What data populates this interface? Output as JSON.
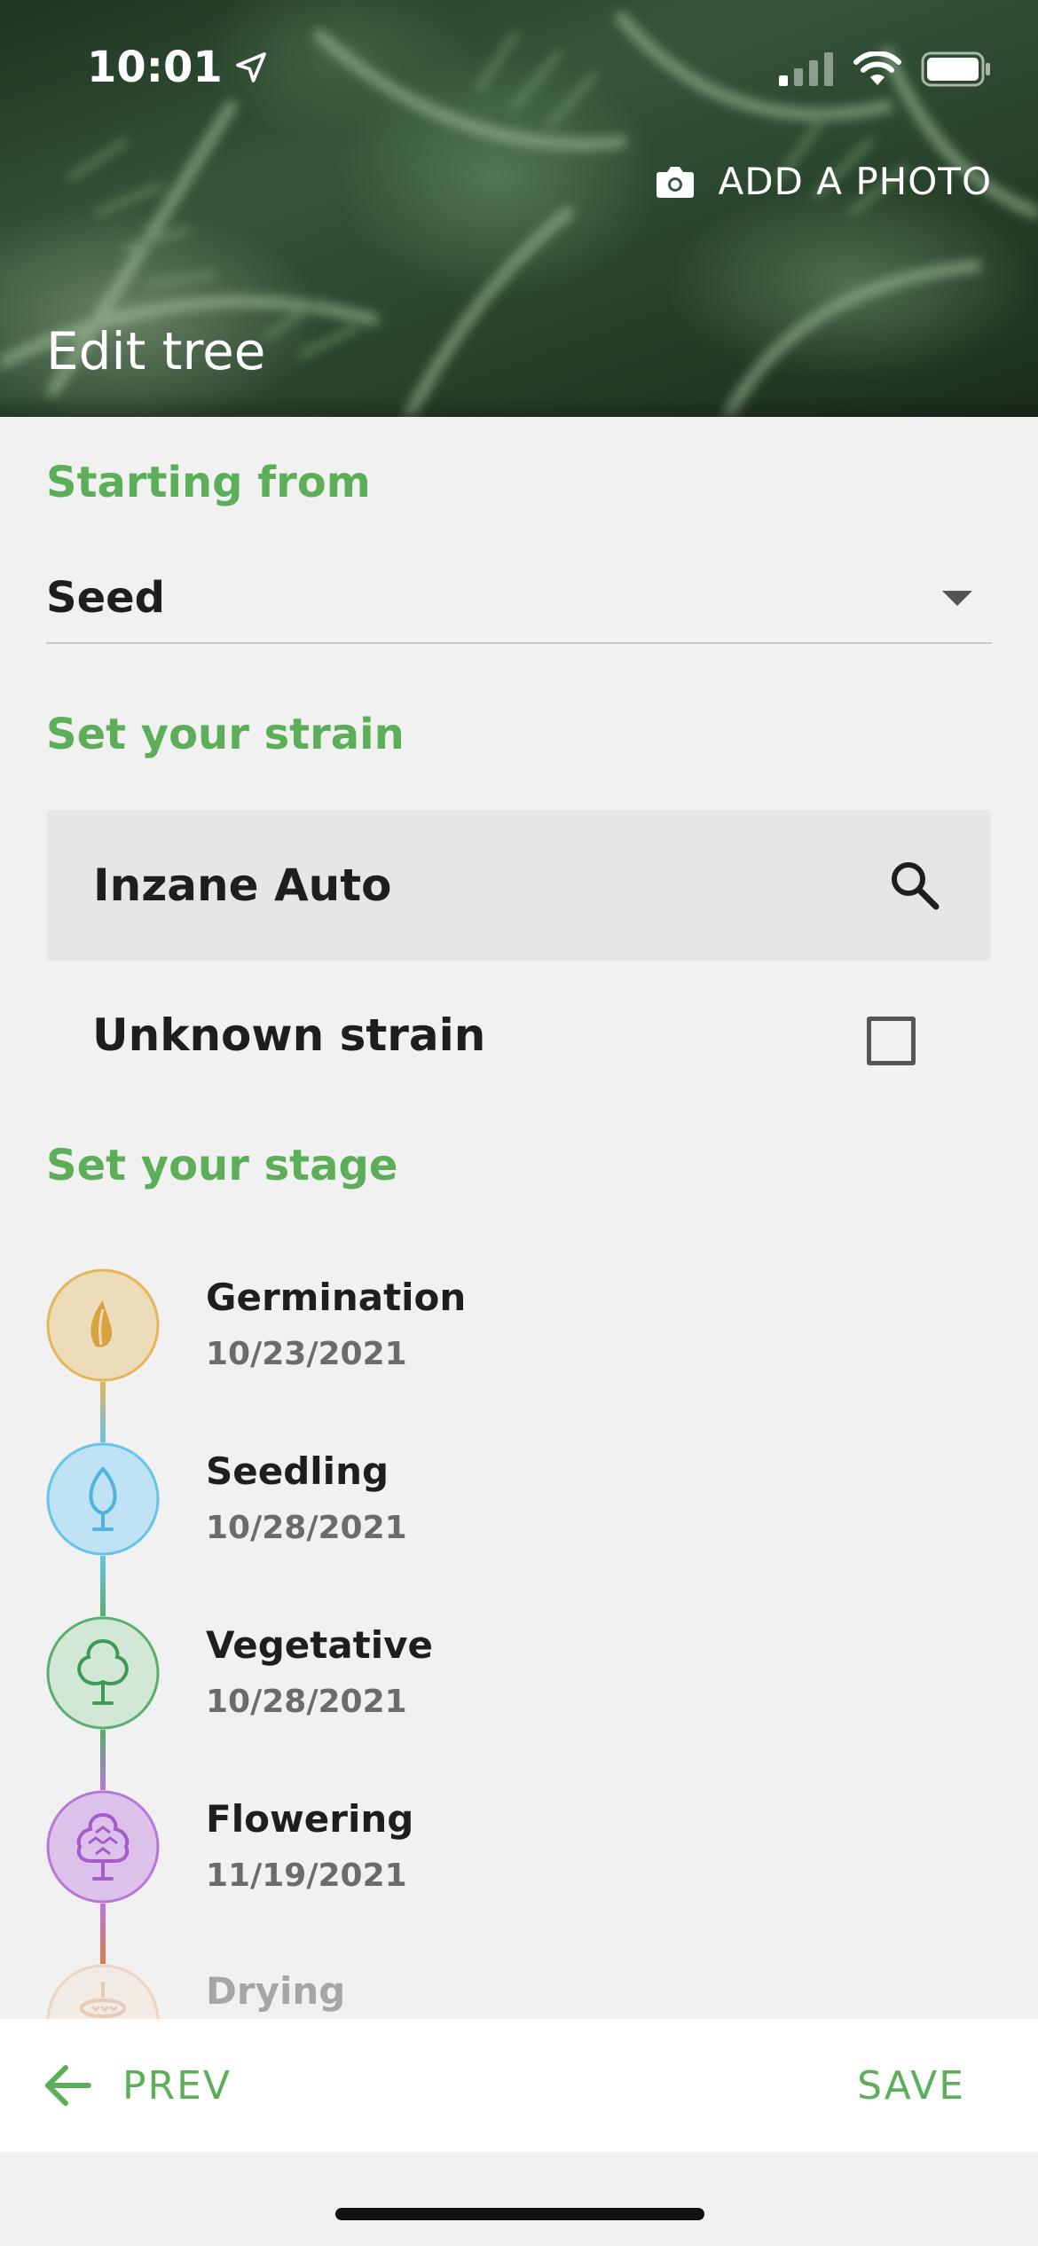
{
  "status_bar": {
    "time": "10:01"
  },
  "header": {
    "add_photo_label": "ADD A PHOTO",
    "title": "Edit tree"
  },
  "starting_from": {
    "section_title": "Starting from",
    "selected": "Seed"
  },
  "strain": {
    "section_title": "Set your strain",
    "value": "Inzane Auto",
    "unknown_label": "Unknown strain",
    "unknown_checked": false
  },
  "stage": {
    "section_title": "Set your stage",
    "items": [
      {
        "name": "Germination",
        "date": "10/23/2021",
        "color": "#e4b55a",
        "fill": "#ecdcba",
        "icon": "sprout-icon"
      },
      {
        "name": "Seedling",
        "date": "10/28/2021",
        "color": "#66c3ea",
        "fill": "#bfe2f4",
        "icon": "leaf-icon"
      },
      {
        "name": "Vegetative",
        "date": "10/28/2021",
        "color": "#5aae6d",
        "fill": "#d2e7d6",
        "icon": "tree-icon"
      },
      {
        "name": "Flowering",
        "date": "11/19/2021",
        "color": "#b877d6",
        "fill": "#dcc2ea",
        "icon": "flower-tree-icon"
      },
      {
        "name": "Drying",
        "date": "",
        "color": "#e7a36a",
        "fill": "#f3e2d2",
        "icon": "drying-icon"
      }
    ]
  },
  "footer": {
    "prev_label": "PREV",
    "save_label": "SAVE"
  },
  "colors": {
    "accent": "#5cae58",
    "background": "#f1f1f1",
    "text": "#1e1e1e",
    "muted": "#6b6b6b"
  }
}
